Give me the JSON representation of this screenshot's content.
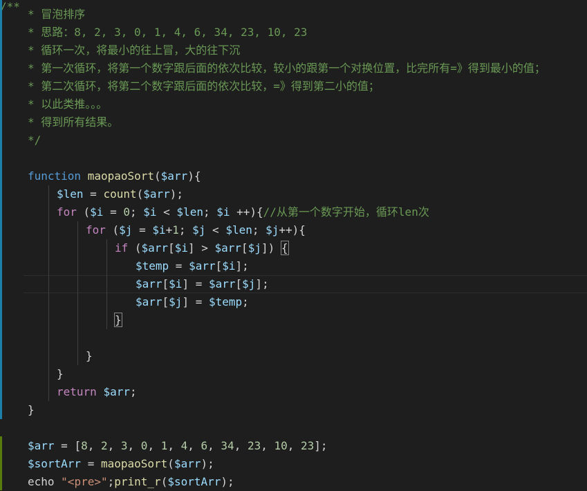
{
  "colors": {
    "background": "#1e1e1e",
    "comment": "#6a9955",
    "keyword": "#c586c0",
    "function": "#dcdcaa",
    "variable": "#9cdcfe",
    "storage": "#569cd6",
    "number": "#b5cea8",
    "string": "#ce9178",
    "modified_gutter": "#1b81a8",
    "added_gutter": "#587c0c"
  },
  "code": {
    "comment_lines": [
      "* 冒泡排序",
      "* 思路：8, 2, 3, 0, 1, 4, 6, 34, 23, 10, 23",
      "* 循环一次，将最小的往上冒，大的往下沉",
      "* 第一次循环，将第一个数字跟后面的依次比较，较小的跟第一个对换位置，比完所有=》得到最小的值；",
      "* 第二次循环，将第二个数字跟后面的依次比较，=》得到第二小的值；",
      "* 以此类推。。。",
      "* 得到所有结果。",
      "*/"
    ],
    "tokens": {
      "function_kw": "function",
      "fn_name": "maopaoSort",
      "open_paren": "(",
      "arr": "$arr",
      "close_paren_brace": "){",
      "len": "$len",
      "assign": " = ",
      "count": "count",
      "close_semi": ");",
      "for_kw": "for",
      "for1_open": " (",
      "i": "$i",
      "eq_zero_a": " = ",
      "zero": "0",
      "semi_space": "; ",
      "lt": " < ",
      "inc_space": " ++",
      "close_brace_open": "){",
      "comment1": "//从第一个数字开始，循环len次",
      "j": "$j",
      "eq": " = ",
      "plus": "+",
      "one": "1",
      "inc": "++",
      "if_kw": "if",
      "lb": "[",
      "rb": "]",
      "gt": " > ",
      "close_paren_space": ") ",
      "open_brace": "{",
      "temp": "$temp",
      "semi": ";",
      "close_brace": "}",
      "return_kw": "return",
      "space": " ",
      "sort_arr": "$sortArr",
      "open_bracket": "[",
      "close_bracket_semi": "];",
      "echo_kw": "echo",
      "pre_str": "\"<pre>\"",
      "print_r": "print_r",
      "comma_space": ", "
    },
    "array_values": [
      "8",
      "2",
      "3",
      "0",
      "1",
      "4",
      "6",
      "34",
      "23",
      "10",
      "23"
    ]
  }
}
